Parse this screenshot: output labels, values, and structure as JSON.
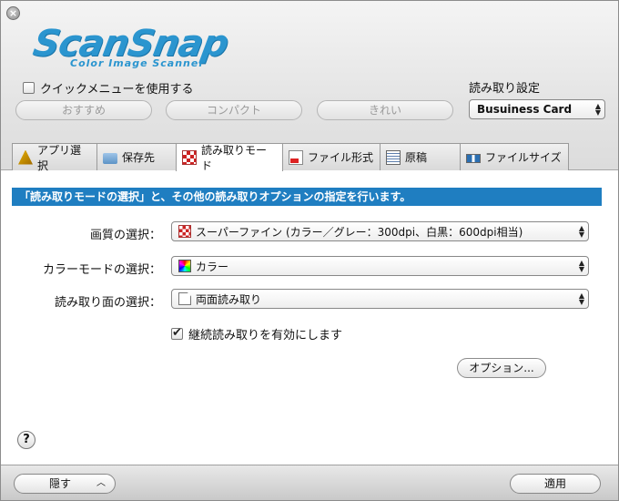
{
  "logo": {
    "text": "ScanSnap",
    "subtitle": "Color Image Scanner"
  },
  "quick_menu": {
    "label": "クイックメニューを使用する",
    "checked": false
  },
  "presets": [
    {
      "label": "おすすめ"
    },
    {
      "label": "コンパクト"
    },
    {
      "label": "きれい"
    }
  ],
  "scan_settings": {
    "label": "読み取り設定",
    "value": "Busuiness Card"
  },
  "tabs": [
    {
      "label": "アプリ選択",
      "icon": "app-icon"
    },
    {
      "label": "保存先",
      "icon": "folder-icon"
    },
    {
      "label": "読み取りモード",
      "icon": "scan-mode-icon",
      "active": true
    },
    {
      "label": "ファイル形式",
      "icon": "file-format-icon"
    },
    {
      "label": "原稿",
      "icon": "document-icon"
    },
    {
      "label": "ファイルサイズ",
      "icon": "file-size-icon"
    }
  ],
  "banner": "「読み取りモードの選択」と、その他の読み取りオプションの指定を行います。",
  "fields": {
    "quality": {
      "label": "画質の選択：",
      "value": "スーパーファイン (カラー／グレー：300dpi、白黒：600dpi相当)"
    },
    "color_mode": {
      "label": "カラーモードの選択：",
      "value": "カラー"
    },
    "scan_side": {
      "label": "読み取り面の選択：",
      "value": "両面読み取り"
    }
  },
  "continuous": {
    "label": "継続読み取りを有効にします",
    "checked": true
  },
  "options_button": "オプション...",
  "help": "?",
  "hide_button": "隠す",
  "apply_button": "適用",
  "colors": {
    "banner": "#1f7ec1",
    "logo": "#2b95cf"
  }
}
